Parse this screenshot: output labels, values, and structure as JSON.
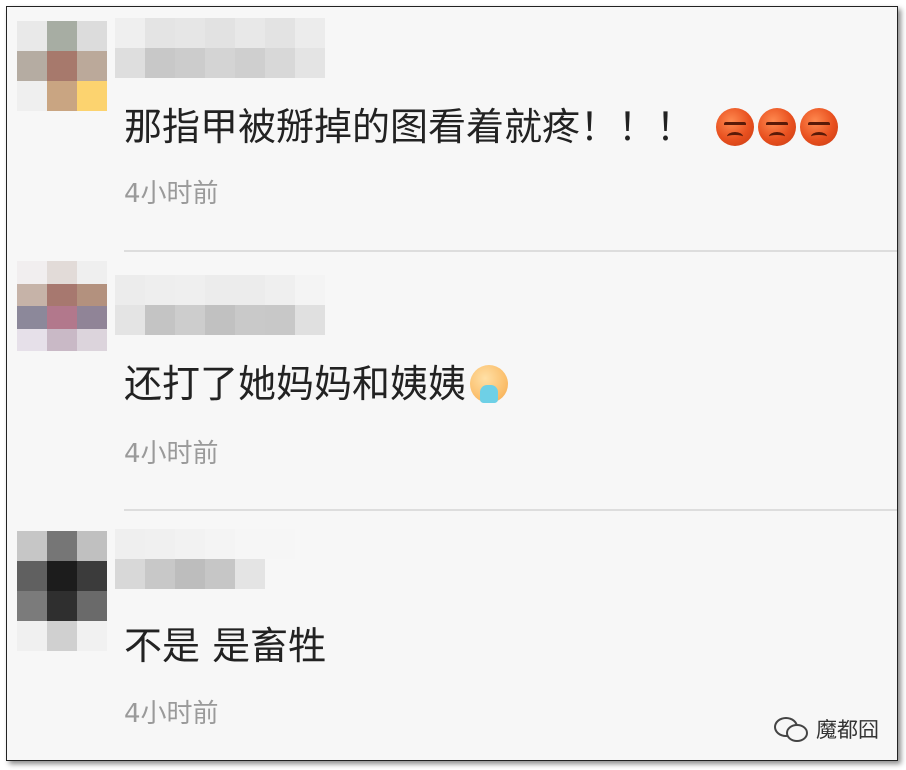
{
  "comments": [
    {
      "text": "那指甲被掰掉的图看着就疼！！！",
      "emoji": [
        "angry-face-emoji",
        "angry-face-emoji",
        "angry-face-emoji"
      ],
      "time": "4小时前",
      "avatar_colors": [
        "#e9e9e9",
        "#a7ada3",
        "#dcdcdc",
        "#b5aca2",
        "#a7796c",
        "#bba99a",
        "#efefef",
        "#c9a582",
        "#fcd36f"
      ],
      "name_colors": [
        "#efefef",
        "#e4e4e4",
        "#e6e6e6",
        "#e2e2e2",
        "#e8e8e8",
        "#e3e3e3",
        "#ececec",
        "#dedede",
        "#c8c8c8",
        "#cccccc",
        "#d4d4d4",
        "#cfcfcf",
        "#d8d8d8",
        "#e4e4e4"
      ]
    },
    {
      "text": "还打了她妈妈和姨姨",
      "emoji": [
        "vomit-face-emoji"
      ],
      "time": "4小时前",
      "avatar_colors": [
        "#f1eeef",
        "#e2dbd8",
        "#efefef",
        "#c6b3a8",
        "#a7786f",
        "#b3917e",
        "#8c889a",
        "#b2788c",
        "#908497",
        "#e6e0e9",
        "#c9b9c6",
        "#dcd4dc"
      ],
      "name_colors": [
        "#ececec",
        "#eeeeee",
        "#efefef",
        "#ececec",
        "#ececec",
        "#efefef",
        "#f4f4f4",
        "#e4e4e4",
        "#c4c4c4",
        "#cdcdcd",
        "#c1c1c1",
        "#c9c9c9",
        "#c8c8c8",
        "#e0e0e0"
      ]
    },
    {
      "text": "不是 是畜牲",
      "emoji": [],
      "time": "4小时前",
      "avatar_colors": [
        "#c6c6c6",
        "#767676",
        "#c0c0c0",
        "#606060",
        "#1c1c1c",
        "#3b3b3b",
        "#7b7b7b",
        "#2f2f2f",
        "#6a6a6a",
        "#f0f0f0",
        "#d0d0d0",
        "#f1f1f1"
      ],
      "name_colors": [
        "#efefef",
        "#f0f0f0",
        "#f2f2f2",
        "#f4f4f4",
        "#f6f6f6",
        "#f6f6f6",
        "#f7f7f7",
        "#d8d8d8",
        "#c8c8c8",
        "#bdbdbd",
        "#c6c6c6",
        "#e4e4e4",
        "#f7f7f7",
        "#f7f7f7"
      ]
    }
  ],
  "watermark": {
    "icon": "wechat-icon",
    "text": "魔都囧"
  }
}
